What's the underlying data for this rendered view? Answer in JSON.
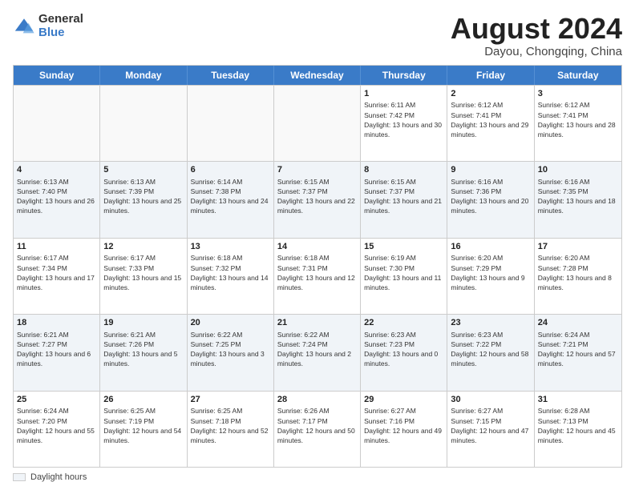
{
  "logo": {
    "general": "General",
    "blue": "Blue"
  },
  "header": {
    "month": "August 2024",
    "location": "Dayou, Chongqing, China"
  },
  "weekdays": [
    "Sunday",
    "Monday",
    "Tuesday",
    "Wednesday",
    "Thursday",
    "Friday",
    "Saturday"
  ],
  "rows": [
    [
      {
        "day": "",
        "text": ""
      },
      {
        "day": "",
        "text": ""
      },
      {
        "day": "",
        "text": ""
      },
      {
        "day": "",
        "text": ""
      },
      {
        "day": "1",
        "text": "Sunrise: 6:11 AM\nSunset: 7:42 PM\nDaylight: 13 hours and 30 minutes."
      },
      {
        "day": "2",
        "text": "Sunrise: 6:12 AM\nSunset: 7:41 PM\nDaylight: 13 hours and 29 minutes."
      },
      {
        "day": "3",
        "text": "Sunrise: 6:12 AM\nSunset: 7:41 PM\nDaylight: 13 hours and 28 minutes."
      }
    ],
    [
      {
        "day": "4",
        "text": "Sunrise: 6:13 AM\nSunset: 7:40 PM\nDaylight: 13 hours and 26 minutes."
      },
      {
        "day": "5",
        "text": "Sunrise: 6:13 AM\nSunset: 7:39 PM\nDaylight: 13 hours and 25 minutes."
      },
      {
        "day": "6",
        "text": "Sunrise: 6:14 AM\nSunset: 7:38 PM\nDaylight: 13 hours and 24 minutes."
      },
      {
        "day": "7",
        "text": "Sunrise: 6:15 AM\nSunset: 7:37 PM\nDaylight: 13 hours and 22 minutes."
      },
      {
        "day": "8",
        "text": "Sunrise: 6:15 AM\nSunset: 7:37 PM\nDaylight: 13 hours and 21 minutes."
      },
      {
        "day": "9",
        "text": "Sunrise: 6:16 AM\nSunset: 7:36 PM\nDaylight: 13 hours and 20 minutes."
      },
      {
        "day": "10",
        "text": "Sunrise: 6:16 AM\nSunset: 7:35 PM\nDaylight: 13 hours and 18 minutes."
      }
    ],
    [
      {
        "day": "11",
        "text": "Sunrise: 6:17 AM\nSunset: 7:34 PM\nDaylight: 13 hours and 17 minutes."
      },
      {
        "day": "12",
        "text": "Sunrise: 6:17 AM\nSunset: 7:33 PM\nDaylight: 13 hours and 15 minutes."
      },
      {
        "day": "13",
        "text": "Sunrise: 6:18 AM\nSunset: 7:32 PM\nDaylight: 13 hours and 14 minutes."
      },
      {
        "day": "14",
        "text": "Sunrise: 6:18 AM\nSunset: 7:31 PM\nDaylight: 13 hours and 12 minutes."
      },
      {
        "day": "15",
        "text": "Sunrise: 6:19 AM\nSunset: 7:30 PM\nDaylight: 13 hours and 11 minutes."
      },
      {
        "day": "16",
        "text": "Sunrise: 6:20 AM\nSunset: 7:29 PM\nDaylight: 13 hours and 9 minutes."
      },
      {
        "day": "17",
        "text": "Sunrise: 6:20 AM\nSunset: 7:28 PM\nDaylight: 13 hours and 8 minutes."
      }
    ],
    [
      {
        "day": "18",
        "text": "Sunrise: 6:21 AM\nSunset: 7:27 PM\nDaylight: 13 hours and 6 minutes."
      },
      {
        "day": "19",
        "text": "Sunrise: 6:21 AM\nSunset: 7:26 PM\nDaylight: 13 hours and 5 minutes."
      },
      {
        "day": "20",
        "text": "Sunrise: 6:22 AM\nSunset: 7:25 PM\nDaylight: 13 hours and 3 minutes."
      },
      {
        "day": "21",
        "text": "Sunrise: 6:22 AM\nSunset: 7:24 PM\nDaylight: 13 hours and 2 minutes."
      },
      {
        "day": "22",
        "text": "Sunrise: 6:23 AM\nSunset: 7:23 PM\nDaylight: 13 hours and 0 minutes."
      },
      {
        "day": "23",
        "text": "Sunrise: 6:23 AM\nSunset: 7:22 PM\nDaylight: 12 hours and 58 minutes."
      },
      {
        "day": "24",
        "text": "Sunrise: 6:24 AM\nSunset: 7:21 PM\nDaylight: 12 hours and 57 minutes."
      }
    ],
    [
      {
        "day": "25",
        "text": "Sunrise: 6:24 AM\nSunset: 7:20 PM\nDaylight: 12 hours and 55 minutes."
      },
      {
        "day": "26",
        "text": "Sunrise: 6:25 AM\nSunset: 7:19 PM\nDaylight: 12 hours and 54 minutes."
      },
      {
        "day": "27",
        "text": "Sunrise: 6:25 AM\nSunset: 7:18 PM\nDaylight: 12 hours and 52 minutes."
      },
      {
        "day": "28",
        "text": "Sunrise: 6:26 AM\nSunset: 7:17 PM\nDaylight: 12 hours and 50 minutes."
      },
      {
        "day": "29",
        "text": "Sunrise: 6:27 AM\nSunset: 7:16 PM\nDaylight: 12 hours and 49 minutes."
      },
      {
        "day": "30",
        "text": "Sunrise: 6:27 AM\nSunset: 7:15 PM\nDaylight: 12 hours and 47 minutes."
      },
      {
        "day": "31",
        "text": "Sunrise: 6:28 AM\nSunset: 7:13 PM\nDaylight: 12 hours and 45 minutes."
      }
    ]
  ],
  "legend": {
    "box_label": "Daylight hours"
  }
}
